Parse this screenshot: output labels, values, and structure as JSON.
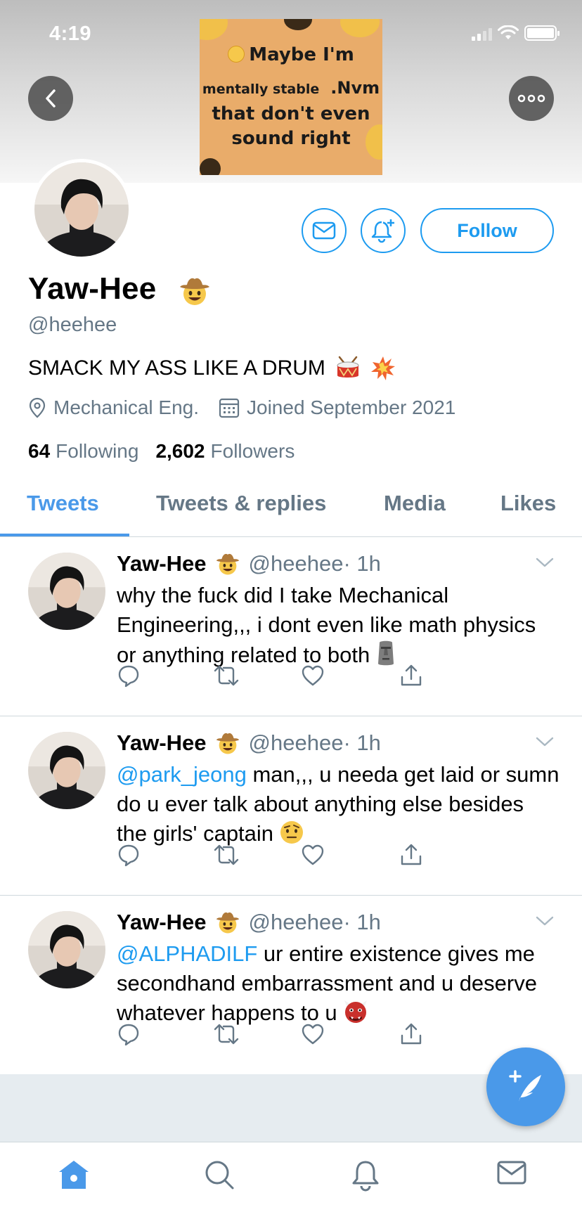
{
  "status_bar": {
    "time": "4:19"
  },
  "banner": {
    "meme_line1": "Maybe I'm",
    "meme_line2_small": "mentally stable",
    "meme_line2_big": ".Nvm",
    "meme_line3": "that don't even",
    "meme_line4": "sound right"
  },
  "profile": {
    "display_name": "Yaw-Hee",
    "handle": "@heehee",
    "bio": "SMACK MY ASS LIKE A DRUM",
    "location": "Mechanical Eng.",
    "joined": "Joined September 2021",
    "following_count": "64",
    "following_label": "Following",
    "followers_count": "2,602",
    "followers_label": "Followers",
    "follow_label": "Follow"
  },
  "tabs": [
    {
      "label": "Tweets",
      "active": true
    },
    {
      "label": "Tweets & replies",
      "active": false
    },
    {
      "label": "Media",
      "active": false
    },
    {
      "label": "Likes",
      "active": false
    }
  ],
  "tweets": [
    {
      "name": "Yaw-Hee",
      "handle": "@heehee",
      "time": "· 1h",
      "mention": "",
      "text": "why the fuck did I take Mechanical Engineering,,, i dont even like math physics or anything related to both",
      "emoji": "moai-icon"
    },
    {
      "name": "Yaw-Hee",
      "handle": "@heehee",
      "time": "· 1h",
      "mention": "@park_jeong",
      "text": " man,,, u needa get laid or sumn do u ever talk about anything else besides the girls' captain",
      "emoji": "raised-eyebrow-face-icon"
    },
    {
      "name": "Yaw-Hee",
      "handle": "@heehee",
      "time": "· 1h",
      "mention": "@ALPHADILF",
      "text": " ur entire existence gives me secondhand embarrassment and u deserve whatever happens to u",
      "emoji": "ogre-icon"
    }
  ],
  "colors": {
    "accent": "#1d9bf0",
    "tab_active": "#4a99e9",
    "muted": "#657786"
  }
}
